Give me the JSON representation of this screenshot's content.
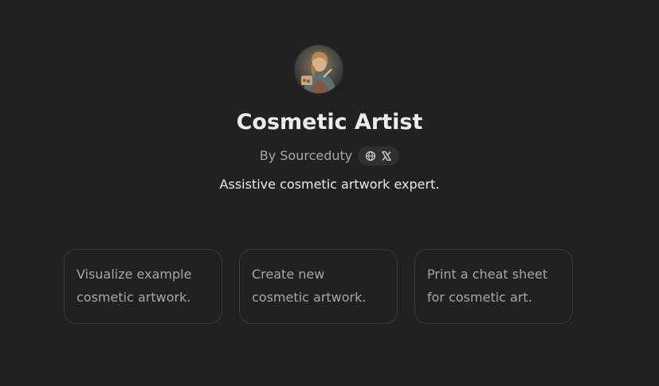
{
  "gpt": {
    "avatar_icon": "portrait-avatar-icon",
    "title": "Cosmetic Artist",
    "byline": "By Sourceduty",
    "links": {
      "website_icon": "globe-icon",
      "social_icon": "x-logo-icon"
    },
    "description": "Assistive cosmetic artwork expert."
  },
  "conversation_starters": [
    {
      "label": "Visualize example cosmetic artwork."
    },
    {
      "label": "Create new cosmetic artwork."
    },
    {
      "label": "Print a cheat sheet for cosmetic art."
    }
  ],
  "colors": {
    "background": "#212121",
    "title": "#ececec",
    "muted_text": "#a8a8a8",
    "card_border": "#3a3a3a",
    "pill_bg": "#303030"
  }
}
